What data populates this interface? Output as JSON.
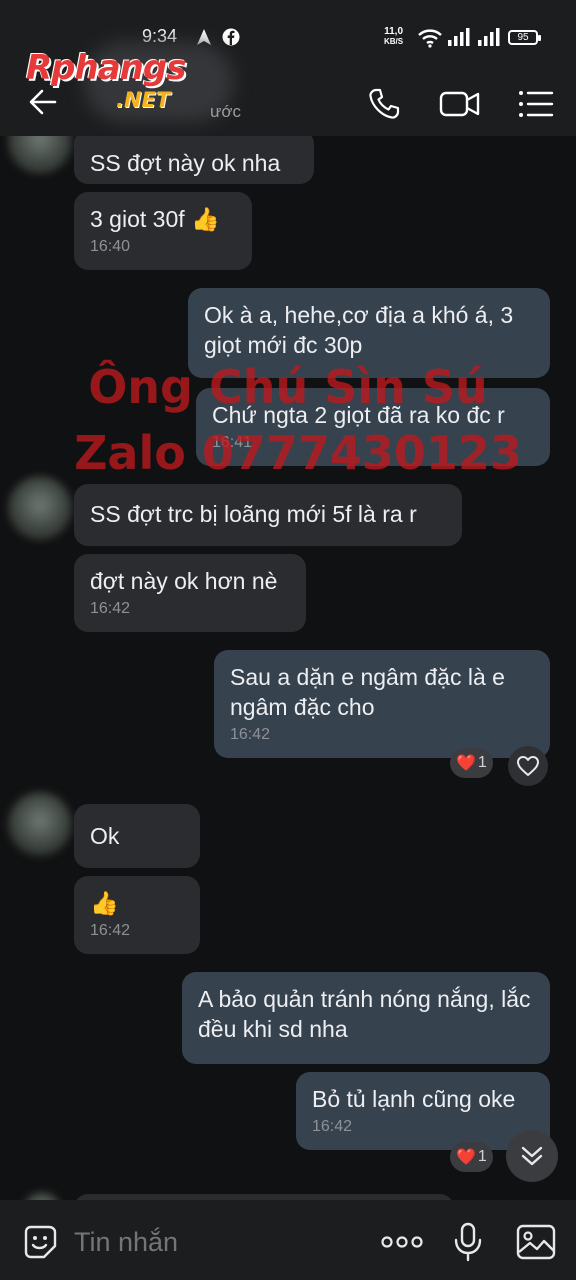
{
  "status_bar": {
    "time": "9:34",
    "net_speed_value": "11,0",
    "net_speed_unit": "KB/S",
    "battery": "95"
  },
  "header": {
    "logo_main": "Rphangs",
    "logo_sub": ".NET",
    "last_seen": "ước"
  },
  "watermark": {
    "line1": "Ông Chú Sìn Sú",
    "line2": "Zalo 0777430123"
  },
  "messages": [
    {
      "dir": "in",
      "text": "SS đợt này ok nha",
      "time": ""
    },
    {
      "dir": "in",
      "text": "3 giot 30f 👍",
      "time": "16:40"
    },
    {
      "dir": "out",
      "text": "Ok à a, hehe,cơ địa a khó á, 3 giọt mới đc 30p",
      "time": ""
    },
    {
      "dir": "out",
      "text": "Chứ ngta 2 giọt đã ra ko đc r",
      "time": "16:41"
    },
    {
      "dir": "in",
      "text": "SS đợt trc bị loãng mới 5f là ra r",
      "time": ""
    },
    {
      "dir": "in",
      "text": "đợt này ok hơn nè",
      "time": "16:42"
    },
    {
      "dir": "out",
      "text": "Sau a dặn e ngâm đặc là e ngâm đặc cho",
      "time": "16:42"
    },
    {
      "dir": "in",
      "text": "Ok",
      "time": ""
    },
    {
      "dir": "in",
      "text": "👍",
      "time": "16:42"
    },
    {
      "dir": "out",
      "text": " A bảo quản tránh nóng nắng, lắc đều khi sd nha",
      "time": ""
    },
    {
      "dir": "out",
      "text": "Bỏ tủ lạnh cũng oke",
      "time": "16:42"
    }
  ],
  "reactions": [
    {
      "emoji": "❤️",
      "count": "1"
    },
    {
      "emoji": "❤️",
      "count": "1"
    }
  ],
  "input": {
    "placeholder": "Tin nhắn"
  },
  "colors": {
    "background": "#101112",
    "bar": "#1c1d1f",
    "incoming_bubble": "#2b2c2f",
    "outgoing_bubble": "#37424f",
    "watermark": "#be1a1e"
  }
}
